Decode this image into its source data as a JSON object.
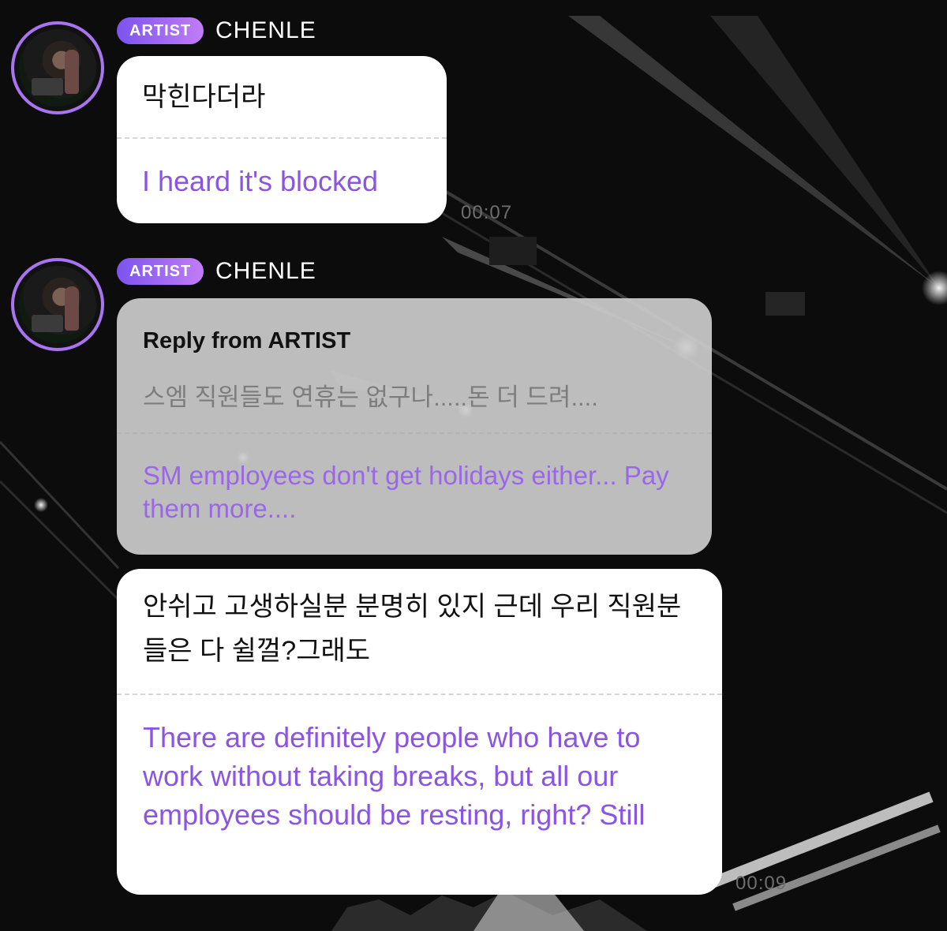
{
  "messages": [
    {
      "badge": "ARTIST",
      "sender": "CHENLE",
      "original": "막힌다더라",
      "translation": "I heard it's blocked",
      "time": "00:07"
    },
    {
      "badge": "ARTIST",
      "sender": "CHENLE",
      "reply": {
        "header": "Reply from ARTIST",
        "original": "스엠 직원들도 연휴는 없구나.....돈 더 드려....",
        "translation": "SM employees don't get holidays either... Pay them more...."
      },
      "original": "안쉬고 고생하실분 분명히 있지 근데 우리 직원분들은 다 쉴껄?그래도",
      "translation": "There are definitely people who have to work without taking breaks, but all our employees should be resting, right? Still",
      "time": "00:09"
    }
  ],
  "colors": {
    "accent": "#8a55e0",
    "badge_start": "#7a54ee",
    "badge_end": "#c27cf7",
    "avatar_ring": "#a874f0"
  }
}
